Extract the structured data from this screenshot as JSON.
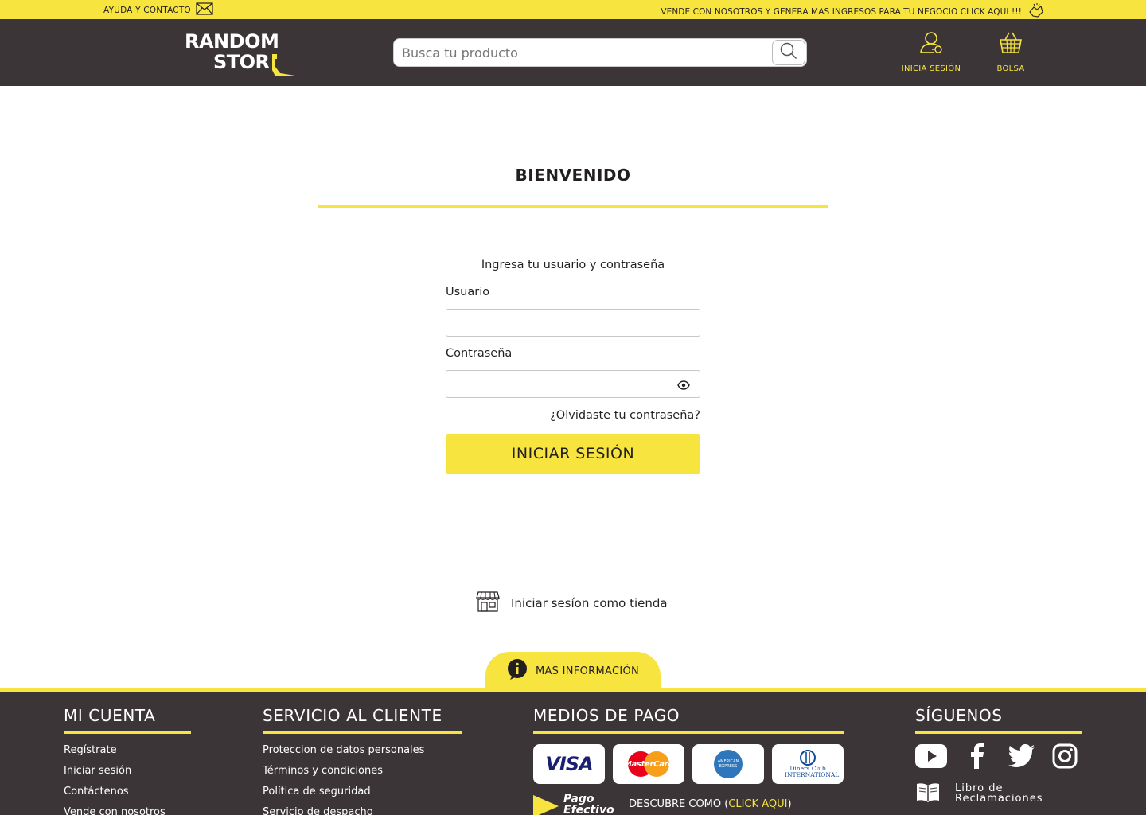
{
  "topbar": {
    "help_label": "AYUDA Y CONTACTO",
    "promo_text": "VENDE CON NOSOTROS Y  GENERA MAS INGRESOS PARA TU NEGOCIO CLICK AQUI !!!"
  },
  "header": {
    "logo_line1": "RANDOM",
    "logo_line2": "STOR",
    "search_placeholder": "Busca tu producto",
    "login_label": "INICIA SESIÓN",
    "bag_label": "BOLSA"
  },
  "main": {
    "title": "BIENVENIDO",
    "instructions": "Ingresa tu usuario y contraseña",
    "username_label": "Usuario",
    "username_value": "",
    "password_label": "Contraseña",
    "password_value": "",
    "forgot_link": "¿Olvidaste tu contraseña?",
    "submit_label": "INICIAR SESIÓN",
    "store_login_label": "Iniciar sesíon como tienda",
    "more_info_label": "MAS INFORMACIÓN"
  },
  "footer": {
    "account": {
      "title": "MI CUENTA",
      "links": [
        "Regístrate",
        "Iniciar sesión",
        "Contáctenos",
        "Vende con nosotros"
      ]
    },
    "service": {
      "title": "SERVICIO AL CLIENTE",
      "links": [
        "Proteccion de datos personales",
        "Términos y condiciones",
        "Política de seguridad",
        "Servicio de despacho"
      ]
    },
    "payment": {
      "title": "MEDIOS DE PAGO",
      "cards": [
        "VISA",
        "MasterCard",
        "AMERICAN EXPRESS",
        "Diners Club INTERNATIONAL"
      ],
      "pago_efectivo_logo": "Pago Efectivo",
      "discover_prefix": "DESCUBRE COMO (",
      "discover_link": "CLICK AQUI",
      "discover_suffix": ")"
    },
    "follow": {
      "title": "SÍGUENOS",
      "networks": [
        "youtube-icon",
        "facebook-icon",
        "twitter-icon",
        "instagram-icon"
      ],
      "complaints_line1": "Libro de",
      "complaints_line2": "Reclamaciones"
    }
  },
  "colors": {
    "accent_yellow": "#f8e43f",
    "dark_bg": "#3b3538",
    "text_dark": "#231f20"
  }
}
